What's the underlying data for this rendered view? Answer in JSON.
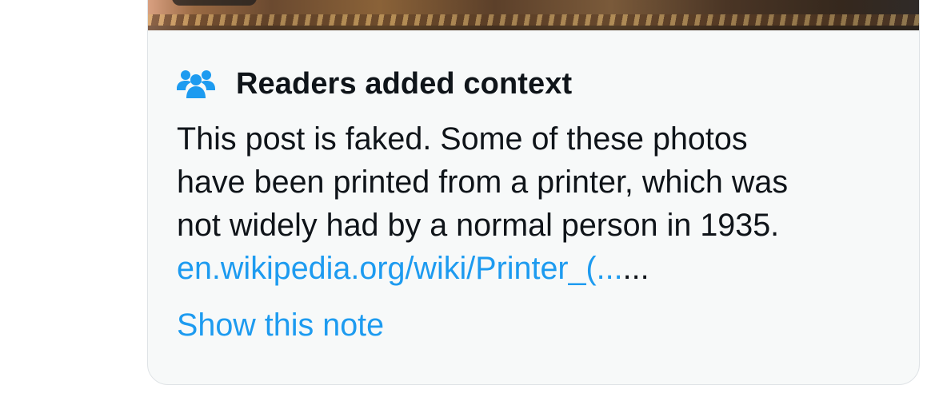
{
  "note_card": {
    "header": {
      "icon": "people-icon",
      "title": "Readers added context"
    },
    "body_lines": [
      "This post is faked. Some of these photos",
      "have been printed from a printer, which was",
      "not widely had by a normal person in 1935."
    ],
    "link": {
      "text": "en.wikipedia.org/wiki/Printer_(...",
      "trailing": "..."
    },
    "show_note_label": "Show this note"
  },
  "colors": {
    "accent": "#1d9bf0",
    "text": "#0f1419",
    "card_background": "#f7f9f9",
    "card_border": "#dfe3e6"
  }
}
